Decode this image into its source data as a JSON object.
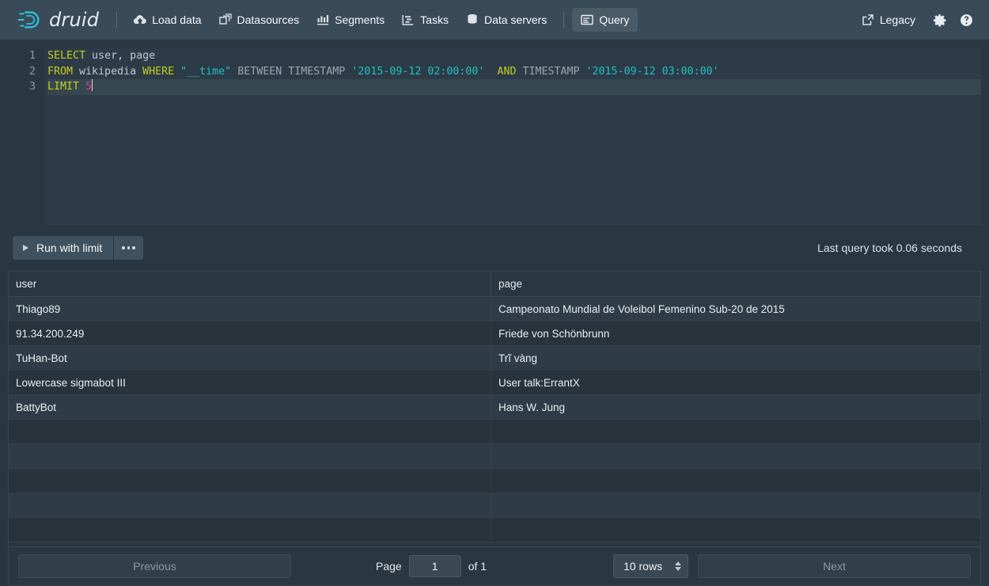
{
  "navbar": {
    "brand": "druid",
    "items": [
      {
        "id": "load-data",
        "label": "Load data",
        "icon": "cloud-upload-icon",
        "active": false
      },
      {
        "id": "datasources",
        "label": "Datasources",
        "icon": "multi-select-icon",
        "active": false
      },
      {
        "id": "segments",
        "label": "Segments",
        "icon": "stacked-chart-icon",
        "active": false
      },
      {
        "id": "tasks",
        "label": "Tasks",
        "icon": "gantt-chart-icon",
        "active": false
      },
      {
        "id": "data-servers",
        "label": "Data servers",
        "icon": "database-icon",
        "active": false
      },
      {
        "id": "query",
        "label": "Query",
        "icon": "application-icon",
        "active": true
      }
    ],
    "legacy_label": "Legacy",
    "legacy_icon": "share-external-icon",
    "settings_icon": "gear-icon",
    "help_icon": "help-circle-icon"
  },
  "editor": {
    "line_numbers": [
      "1",
      "2",
      "3"
    ],
    "full_query": "SELECT user, page\nFROM wikipedia WHERE \"__time\" BETWEEN TIMESTAMP '2015-09-12 02:00:00' AND TIMESTAMP '2015-09-12 03:00:00'\nLIMIT 5",
    "lines": [
      {
        "n": "1",
        "tokens": [
          {
            "t": "SELECT",
            "c": "tok-kw"
          },
          {
            "t": " user, page",
            "c": "tok-plain"
          }
        ]
      },
      {
        "n": "2",
        "tokens": [
          {
            "t": "FROM",
            "c": "tok-kw"
          },
          {
            "t": " wikipedia ",
            "c": "tok-plain"
          },
          {
            "t": "WHERE",
            "c": "tok-kw"
          },
          {
            "t": " ",
            "c": "tok-plain"
          },
          {
            "t": "\"__time\"",
            "c": "tok-str"
          },
          {
            "t": " BETWEEN TIMESTAMP ",
            "c": "tok-fn"
          },
          {
            "t": "'2015-09-12 02:00:00'",
            "c": "tok-str"
          },
          {
            "t": "  ",
            "c": "tok-plain"
          },
          {
            "t": "AND",
            "c": "tok-kw"
          },
          {
            "t": " TIMESTAMP ",
            "c": "tok-fn"
          },
          {
            "t": "'2015-09-12 03:00:00'",
            "c": "tok-str"
          }
        ]
      },
      {
        "n": "3",
        "tokens": [
          {
            "t": "LIMIT",
            "c": "tok-kw"
          },
          {
            "t": " ",
            "c": "tok-plain"
          },
          {
            "t": "5",
            "c": "tok-num"
          }
        ]
      }
    ]
  },
  "toolbar": {
    "run_label": "Run with limit",
    "more_label": "more-options",
    "query_time": "Last query took 0.06 seconds"
  },
  "results": {
    "columns": [
      "user",
      "page"
    ],
    "rows": [
      [
        "Thiago89",
        "Campeonato Mundial de Voleibol Femenino Sub-20 de 2015"
      ],
      [
        "91.34.200.249",
        "Friede von Schönbrunn"
      ],
      [
        "TuHan-Bot",
        "Trĩ vàng"
      ],
      [
        "Lowercase sigmabot III",
        "User talk:ErrantX"
      ],
      [
        "BattyBot",
        "Hans W. Jung"
      ]
    ],
    "empty_row_count": 5
  },
  "pagination": {
    "previous_label": "Previous",
    "next_label": "Next",
    "page_label": "Page",
    "page_value": "1",
    "of_label": "of 1",
    "rows_per_page": "10 rows"
  },
  "colors": {
    "navbar_bg": "#394B59",
    "page_bg": "#293742",
    "editor_code_bg": "#2C3B47",
    "row_odd": "#2F3C47",
    "row_even": "#28333C",
    "accent_cyan": "#1FC2C2",
    "keyword_yellow": "#C2CF18",
    "number_pink": "#E0409B"
  }
}
